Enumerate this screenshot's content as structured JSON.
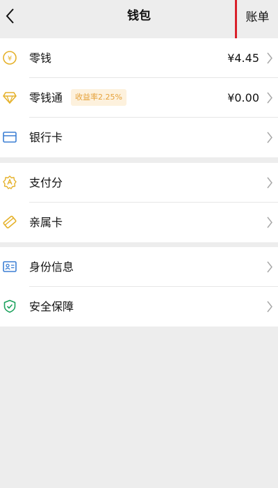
{
  "nav": {
    "title": "钱包",
    "bill_label": "账单"
  },
  "group_1": [
    {
      "label": "零钱",
      "value": "¥4.45",
      "icon": "yuan-coin-icon"
    },
    {
      "label": "零钱通",
      "badge": "收益率2.25%",
      "value": "¥0.00",
      "icon": "diamond-icon"
    },
    {
      "label": "银行卡",
      "icon": "bank-card-icon"
    }
  ],
  "group_2": [
    {
      "label": "支付分",
      "icon": "payment-score-icon"
    },
    {
      "label": "亲属卡",
      "icon": "family-card-icon"
    }
  ],
  "group_3": [
    {
      "label": "身份信息",
      "icon": "id-card-icon"
    },
    {
      "label": "安全保障",
      "icon": "shield-icon"
    }
  ],
  "colors": {
    "background": "#ededed",
    "surface": "#ffffff",
    "highlight_border": "#d9202a",
    "gold": "#e5b12a",
    "blue": "#3b7fd4",
    "green": "#19a15b",
    "badge_bg": "#fdf1dd",
    "badge_text": "#e5a139"
  }
}
